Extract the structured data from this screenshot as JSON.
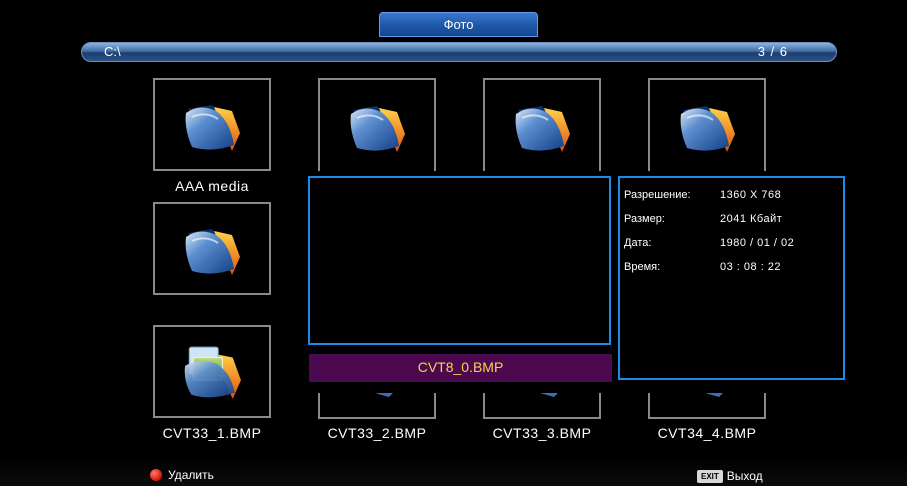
{
  "header": {
    "title": "Фото"
  },
  "path_bar": {
    "path": "C:\\",
    "page_indicator": "3 / 6"
  },
  "grid": {
    "row1": [
      {
        "label": "AAA media",
        "icon": "folder-icon"
      },
      {
        "label": "",
        "icon": "folder-icon"
      },
      {
        "label": "",
        "icon": "folder-icon"
      },
      {
        "label": "",
        "icon": "folder-icon"
      }
    ],
    "row2_first": {
      "label": "",
      "icon": "folder-icon"
    },
    "row3": [
      {
        "label": "CVT33_1.BMP",
        "icon": "image-folder-icon"
      },
      {
        "label": "CVT33_2.BMP",
        "icon": "image-icon"
      },
      {
        "label": "CVT33_3.BMP",
        "icon": "image-icon"
      },
      {
        "label": "CVT34_4.BMP",
        "icon": "image-icon"
      }
    ]
  },
  "preview": {
    "selected_file": "CVT8_0.BMP"
  },
  "info": {
    "resolution_label": "Разрешение:",
    "resolution_value": "1360 X 768",
    "size_label": "Размер:",
    "size_value": "2041 Кбайт",
    "date_label": "Дата:",
    "date_value": "1980 / 01 / 02",
    "time_label": "Время:",
    "time_value": "03 : 08 : 22"
  },
  "footer": {
    "delete_label": "Удалить",
    "exit_badge": "EXIT",
    "exit_label": "Выход"
  },
  "colors": {
    "accent": "#1c8ae6",
    "selection_bg": "#4b0a50",
    "selection_text": "#f4d54a"
  }
}
